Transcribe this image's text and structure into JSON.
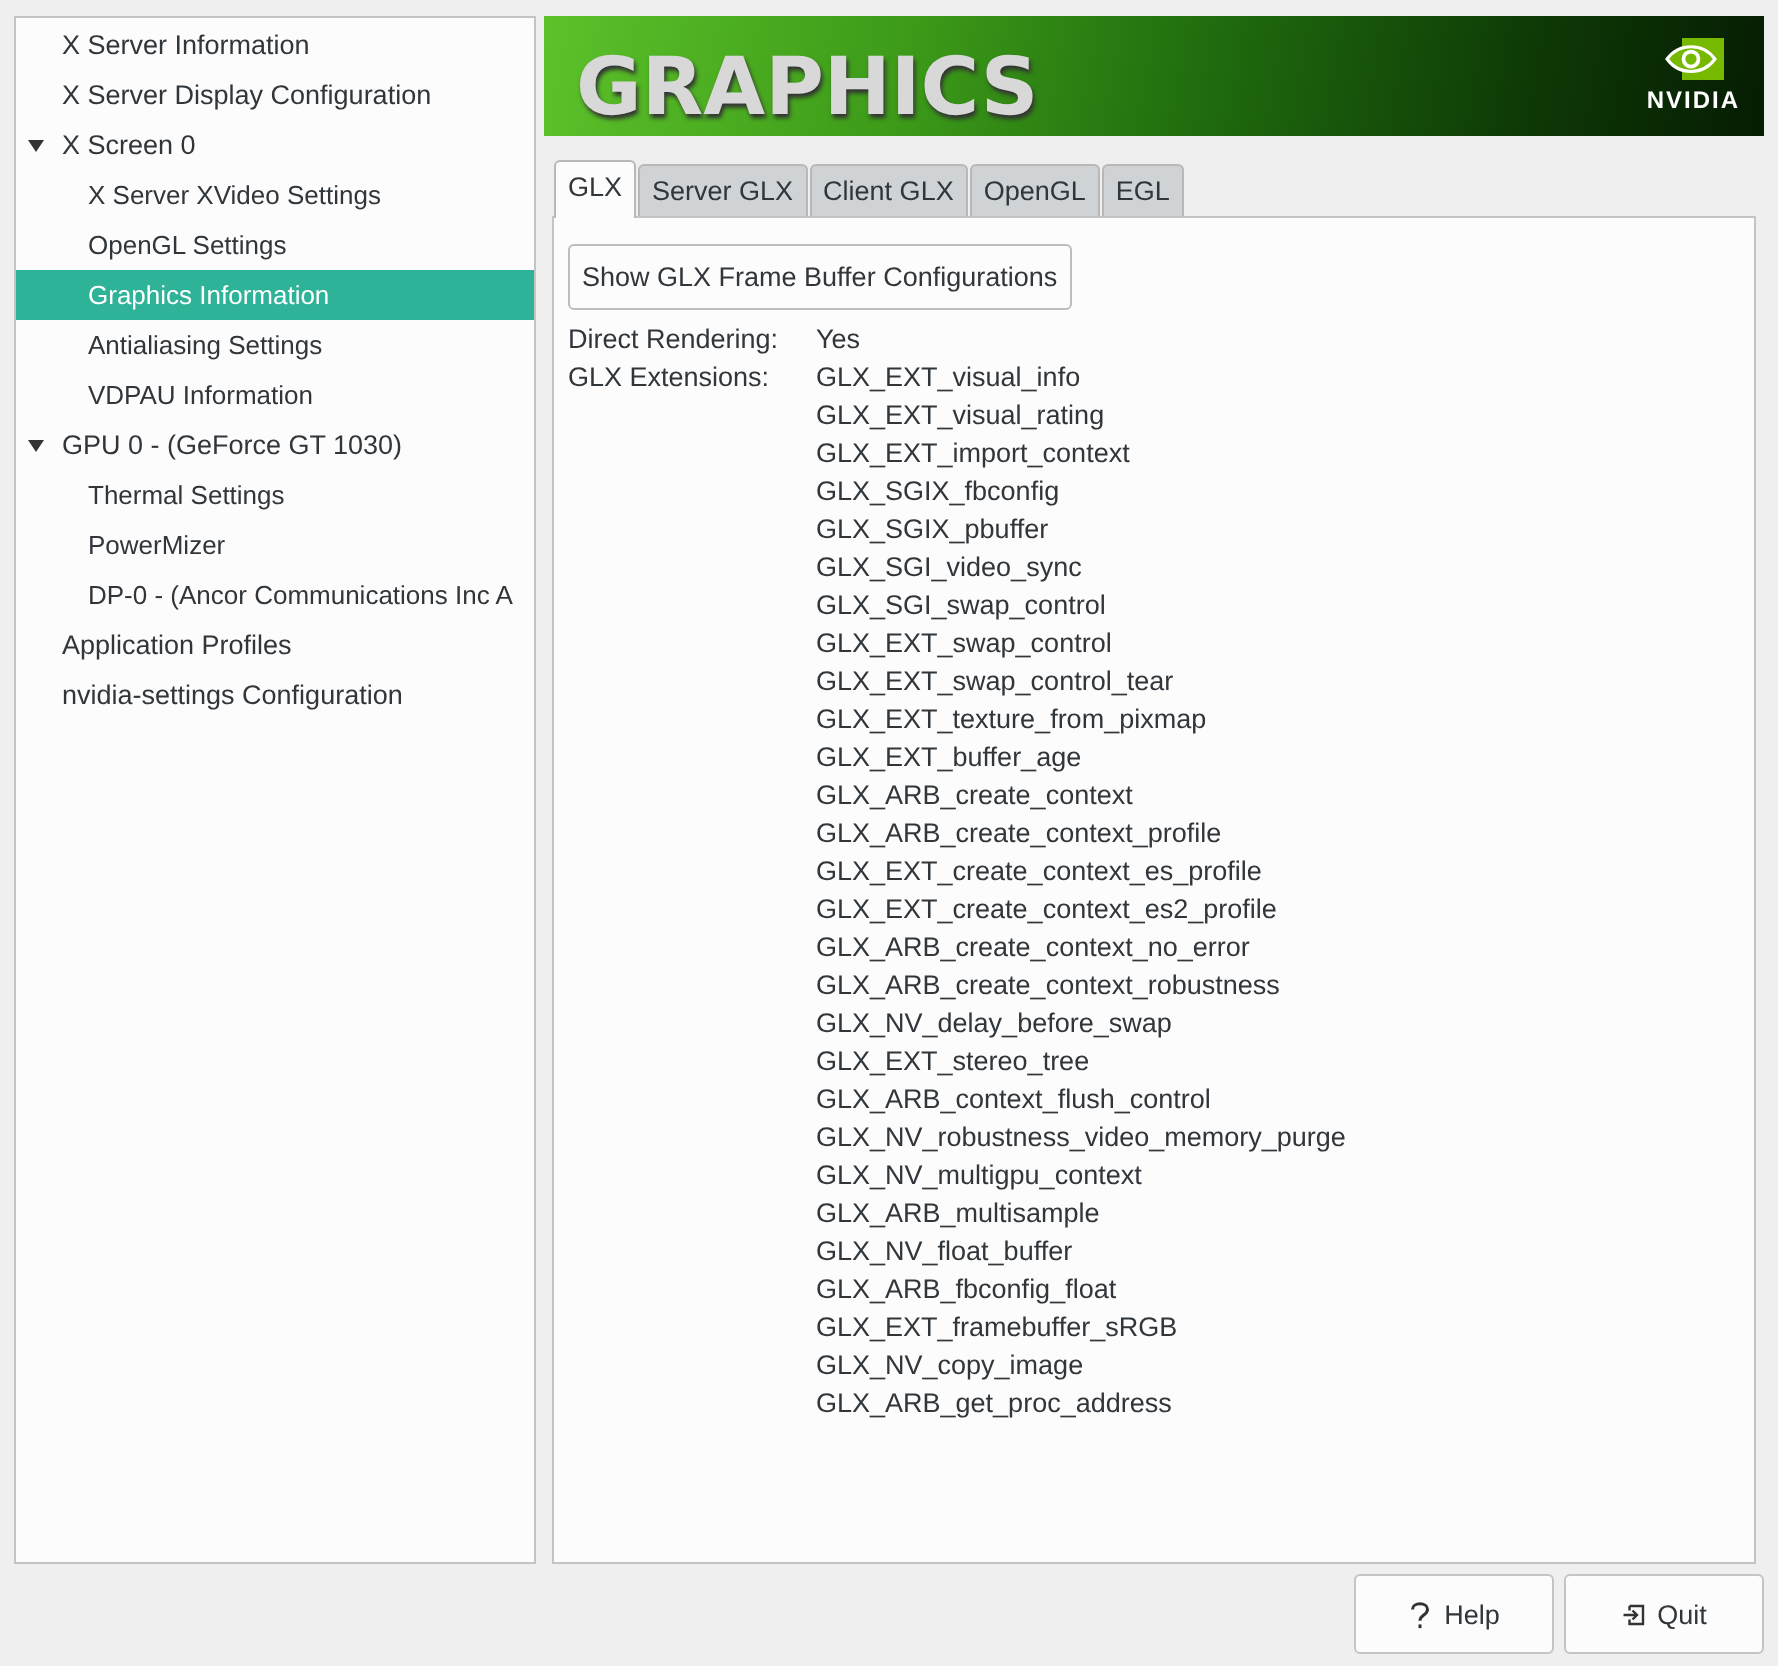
{
  "sidebar": {
    "items": [
      {
        "label": "X Server Information",
        "selected": false
      },
      {
        "label": "X Server Display Configuration",
        "selected": false
      },
      {
        "label": "X Screen 0",
        "selected": false,
        "expanded": true,
        "children": [
          {
            "label": "X Server XVideo Settings",
            "selected": false
          },
          {
            "label": "OpenGL Settings",
            "selected": false
          },
          {
            "label": "Graphics Information",
            "selected": true
          },
          {
            "label": "Antialiasing Settings",
            "selected": false
          },
          {
            "label": "VDPAU Information",
            "selected": false
          }
        ]
      },
      {
        "label": "GPU 0 - (GeForce GT 1030)",
        "selected": false,
        "expanded": true,
        "children": [
          {
            "label": "Thermal Settings",
            "selected": false
          },
          {
            "label": "PowerMizer",
            "selected": false
          },
          {
            "label": "DP-0 - (Ancor Communications Inc A",
            "selected": false
          }
        ]
      },
      {
        "label": "Application Profiles",
        "selected": false
      },
      {
        "label": "nvidia-settings Configuration",
        "selected": false
      }
    ]
  },
  "banner": {
    "title": "GRAPHICS",
    "logo_text": "NVIDIA"
  },
  "tabs": [
    {
      "label": "GLX",
      "selected": true
    },
    {
      "label": "Server GLX",
      "selected": false
    },
    {
      "label": "Client GLX",
      "selected": false
    },
    {
      "label": "OpenGL",
      "selected": false
    },
    {
      "label": "EGL",
      "selected": false
    }
  ],
  "panel": {
    "button": "Show GLX Frame Buffer Configurations",
    "fields": [
      {
        "label": "Direct Rendering:",
        "values": [
          "Yes"
        ]
      },
      {
        "label": "GLX Extensions:",
        "values": [
          "GLX_EXT_visual_info",
          "GLX_EXT_visual_rating",
          "GLX_EXT_import_context",
          "GLX_SGIX_fbconfig",
          "GLX_SGIX_pbuffer",
          "GLX_SGI_video_sync",
          "GLX_SGI_swap_control",
          "GLX_EXT_swap_control",
          "GLX_EXT_swap_control_tear",
          "GLX_EXT_texture_from_pixmap",
          "GLX_EXT_buffer_age",
          "GLX_ARB_create_context",
          "GLX_ARB_create_context_profile",
          "GLX_EXT_create_context_es_profile",
          "GLX_EXT_create_context_es2_profile",
          "GLX_ARB_create_context_no_error",
          "GLX_ARB_create_context_robustness",
          "GLX_NV_delay_before_swap",
          "GLX_EXT_stereo_tree",
          "GLX_ARB_context_flush_control",
          "GLX_NV_robustness_video_memory_purge",
          "GLX_NV_multigpu_context",
          "GLX_ARB_multisample",
          "GLX_NV_float_buffer",
          "GLX_ARB_fbconfig_float",
          "GLX_EXT_framebuffer_sRGB",
          "GLX_NV_copy_image",
          "GLX_ARB_get_proc_address"
        ]
      }
    ]
  },
  "buttons": [
    {
      "kind": "help",
      "label": "Help"
    },
    {
      "kind": "quit",
      "label": "Quit"
    }
  ]
}
